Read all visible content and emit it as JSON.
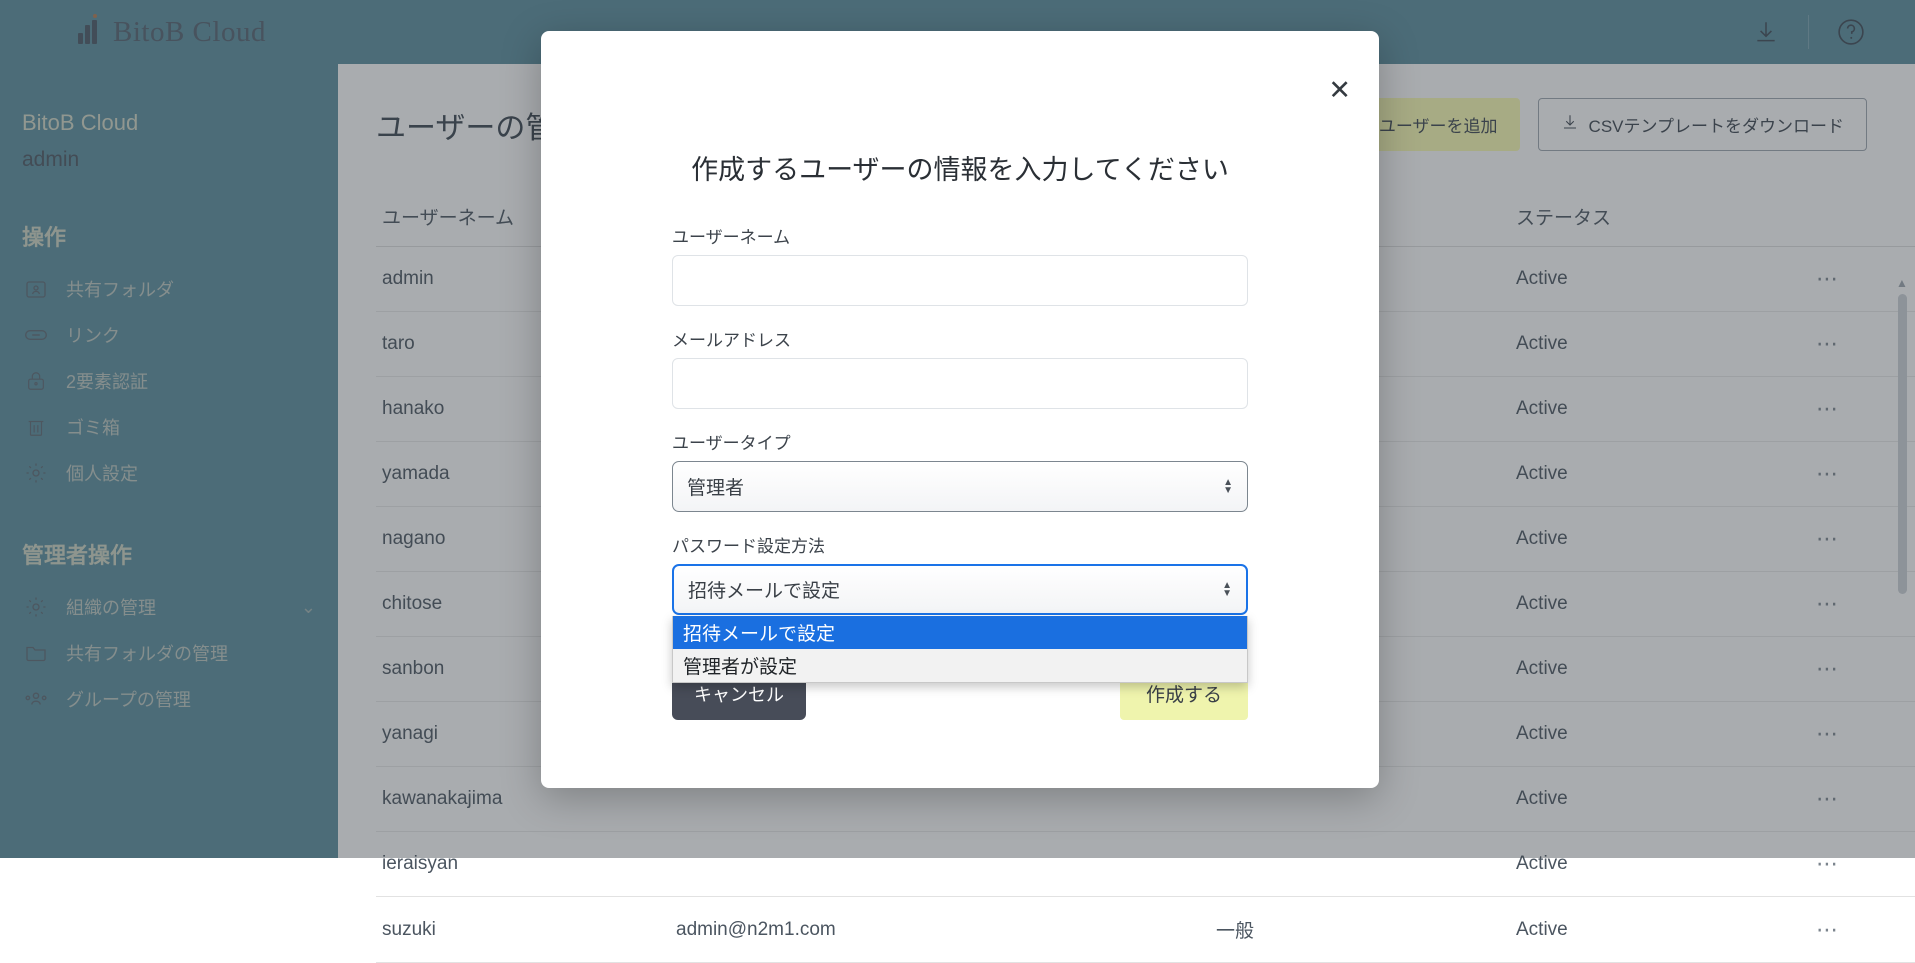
{
  "topbar": {
    "brand": "BitoB Cloud",
    "download_icon": "download-icon",
    "help_icon": "help-circle-icon"
  },
  "sidebar": {
    "org_name": "BitoB Cloud",
    "user_name": "admin",
    "section_operations": "操作",
    "section_admin": "管理者操作",
    "operations": [
      {
        "label": "共有フォルダ",
        "icon": "shared-folder-icon"
      },
      {
        "label": "リンク",
        "icon": "link-icon"
      },
      {
        "label": "2要素認証",
        "icon": "lock-icon"
      },
      {
        "label": "ゴミ箱",
        "icon": "trash-icon"
      },
      {
        "label": "個人設定",
        "icon": "gear-icon"
      }
    ],
    "admin": [
      {
        "label": "組織の管理",
        "icon": "gear-icon",
        "chevron": "⌄"
      },
      {
        "label": "共有フォルダの管理",
        "icon": "folder-icon",
        "chevron": ""
      },
      {
        "label": "グループの管理",
        "icon": "group-icon",
        "chevron": ""
      }
    ]
  },
  "page": {
    "title": "ユーザーの管理",
    "btn_csv_add": "CSVでユーザーを追加",
    "btn_csv_template": "CSVテンプレートをダウンロード",
    "download_icon": "download-icon"
  },
  "table": {
    "headers": {
      "name": "ユーザーネーム",
      "mail": "",
      "type": "",
      "status": "ステータス",
      "menu": ""
    },
    "rows": [
      {
        "name": "admin",
        "mail": "",
        "type": "",
        "status": "Active",
        "menu": "⋯"
      },
      {
        "name": "taro",
        "mail": "",
        "type": "",
        "status": "Active",
        "menu": "⋯"
      },
      {
        "name": "hanako",
        "mail": "",
        "type": "",
        "status": "Active",
        "menu": "⋯"
      },
      {
        "name": "yamada",
        "mail": "",
        "type": "",
        "status": "Active",
        "menu": "⋯"
      },
      {
        "name": "nagano",
        "mail": "",
        "type": "",
        "status": "Active",
        "menu": "⋯"
      },
      {
        "name": "chitose",
        "mail": "",
        "type": "",
        "status": "Active",
        "menu": "⋯"
      },
      {
        "name": "sanbon",
        "mail": "",
        "type": "",
        "status": "Active",
        "menu": "⋯"
      },
      {
        "name": "yanagi",
        "mail": "",
        "type": "",
        "status": "Active",
        "menu": "⋯"
      },
      {
        "name": "kawanakajima",
        "mail": "",
        "type": "",
        "status": "Active",
        "menu": "⋯"
      },
      {
        "name": "ieraisyan",
        "mail": "",
        "type": "",
        "status": "Active",
        "menu": "⋯"
      },
      {
        "name": "suzuki",
        "mail": "admin@n2m1.com",
        "type": "一般",
        "status": "Active",
        "menu": "⋯"
      }
    ]
  },
  "modal": {
    "close_icon": "close-icon",
    "title": "作成するユーザーの情報を入力してください",
    "fields": {
      "username_label": "ユーザーネーム",
      "username_value": "",
      "email_label": "メールアドレス",
      "email_value": "",
      "usertype_label": "ユーザータイプ",
      "usertype_value": "管理者",
      "password_label": "パスワード設定方法",
      "password_value": "招待メールで設定"
    },
    "password_options": [
      {
        "label": "招待メールで設定",
        "selected": true
      },
      {
        "label": "管理者が設定",
        "selected": false
      }
    ],
    "btn_cancel": "キャンセル",
    "btn_create": "作成する"
  },
  "colors": {
    "brand_bar": "#5b8b9a",
    "accent_yellow": "#eff4ad",
    "select_highlight": "#1a6fe0",
    "focus_border": "#1a73e8",
    "cancel_button": "#474c58"
  }
}
